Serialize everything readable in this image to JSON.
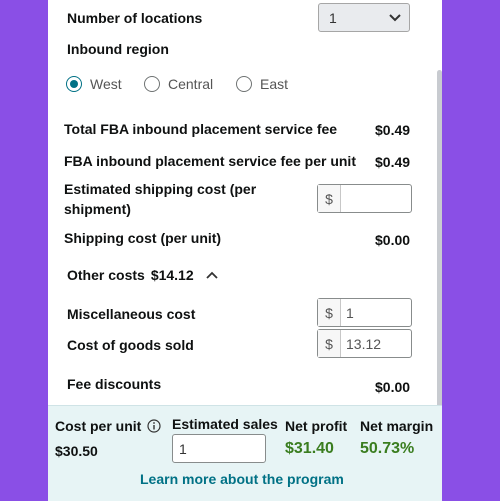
{
  "locations": {
    "label": "Number of locations",
    "selected": "1"
  },
  "region": {
    "label": "Inbound region",
    "options": [
      "West",
      "Central",
      "East"
    ],
    "selected": "West"
  },
  "fees": {
    "total_fba_label": "Total FBA inbound placement service fee",
    "total_fba_value": "$0.49",
    "per_unit_label": "FBA inbound placement service fee per unit",
    "per_unit_value": "$0.49",
    "est_shipping_label_1": "Estimated shipping cost (per",
    "est_shipping_label_2": "shipment)",
    "est_shipping_value": "",
    "shipping_per_unit_label": "Shipping cost (per unit)",
    "shipping_per_unit_value": "$0.00"
  },
  "other_costs": {
    "label": "Other costs",
    "total": "$14.12",
    "misc_label": "Miscellaneous cost",
    "misc_value": "1",
    "cogs_label": "Cost of goods sold",
    "cogs_value": "13.12",
    "fee_discounts_label": "Fee discounts",
    "fee_discounts_value": "$0.00"
  },
  "currency_symbol": "$",
  "footer": {
    "cost_per_unit_label": "Cost per unit",
    "cost_per_unit_value": "$30.50",
    "estimated_sales_label": "Estimated sales",
    "estimated_sales_value": "1",
    "net_profit_label": "Net profit",
    "net_profit_value": "$31.40",
    "net_margin_label": "Net margin",
    "net_margin_value": "50.73%",
    "learn_more": "Learn more about the program"
  },
  "colors": {
    "background": "#8a4fe6",
    "accent": "#007185",
    "profit_green": "#3a7d1f"
  }
}
